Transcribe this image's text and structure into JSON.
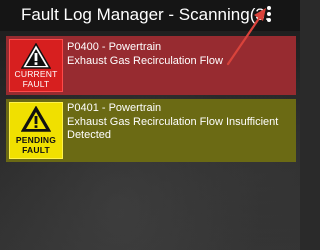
{
  "app_bar": {
    "title": "Fault Log Manager - Scanning(3...",
    "overflow_menu_icon": "more-vert-icon"
  },
  "colors": {
    "app_bar_bg": "#151515",
    "current_fault_card": "#972b30",
    "current_fault_badge": "#d71f1f",
    "pending_fault_card": "#6b6a14",
    "pending_fault_badge": "#f0e000",
    "annotation_arrow": "#d9433b"
  },
  "faults": [
    {
      "status_line1": "CURRENT",
      "status_line2": "FAULT",
      "icon": "warning-triangle-icon",
      "code_line": "P0400 - Powertrain",
      "description": "Exhaust Gas Recirculation Flow"
    },
    {
      "status_line1": "PENDING",
      "status_line2": "FAULT",
      "icon": "warning-triangle-icon",
      "code_line": "P0401 - Powertrain",
      "description": "Exhaust Gas Recirculation Flow Insufficient Detected"
    }
  ]
}
